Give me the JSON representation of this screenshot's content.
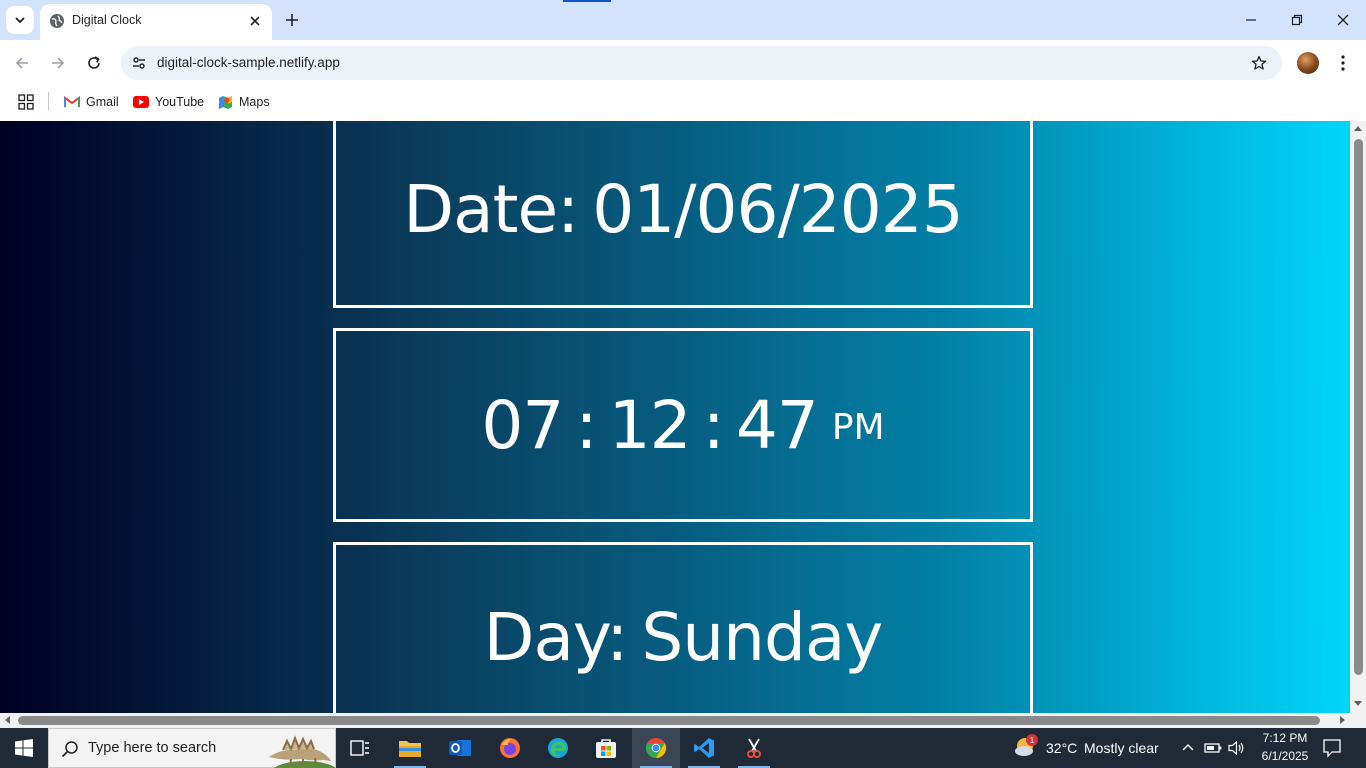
{
  "browser": {
    "tab": {
      "title": "Digital Clock"
    },
    "url": "digital-clock-sample.netlify.app",
    "bookmarks": [
      {
        "label": "Gmail",
        "icon": "gmail-icon"
      },
      {
        "label": "YouTube",
        "icon": "youtube-icon"
      },
      {
        "label": "Maps",
        "icon": "maps-icon"
      }
    ]
  },
  "clock": {
    "date_label": "Date:",
    "date_value": "01/06/2025",
    "time_hh": "07",
    "time_mm": "12",
    "time_ss": "47",
    "separator": ":",
    "ampm": "PM",
    "day_label": "Day:",
    "day_value": "Sunday"
  },
  "taskbar": {
    "search_placeholder": "Type here to search",
    "weather": {
      "temp": "32°C",
      "condition": "Mostly clear",
      "badge": "1"
    },
    "clock_time": "7:12 PM",
    "clock_date": "6/1/2025"
  },
  "colors": {
    "page_gradient": [
      "#000022",
      "#0a3a5a",
      "#0380a6",
      "#00d6fb"
    ],
    "tabstrip": "#d3e3fd",
    "taskbar": "#1f2a36"
  }
}
